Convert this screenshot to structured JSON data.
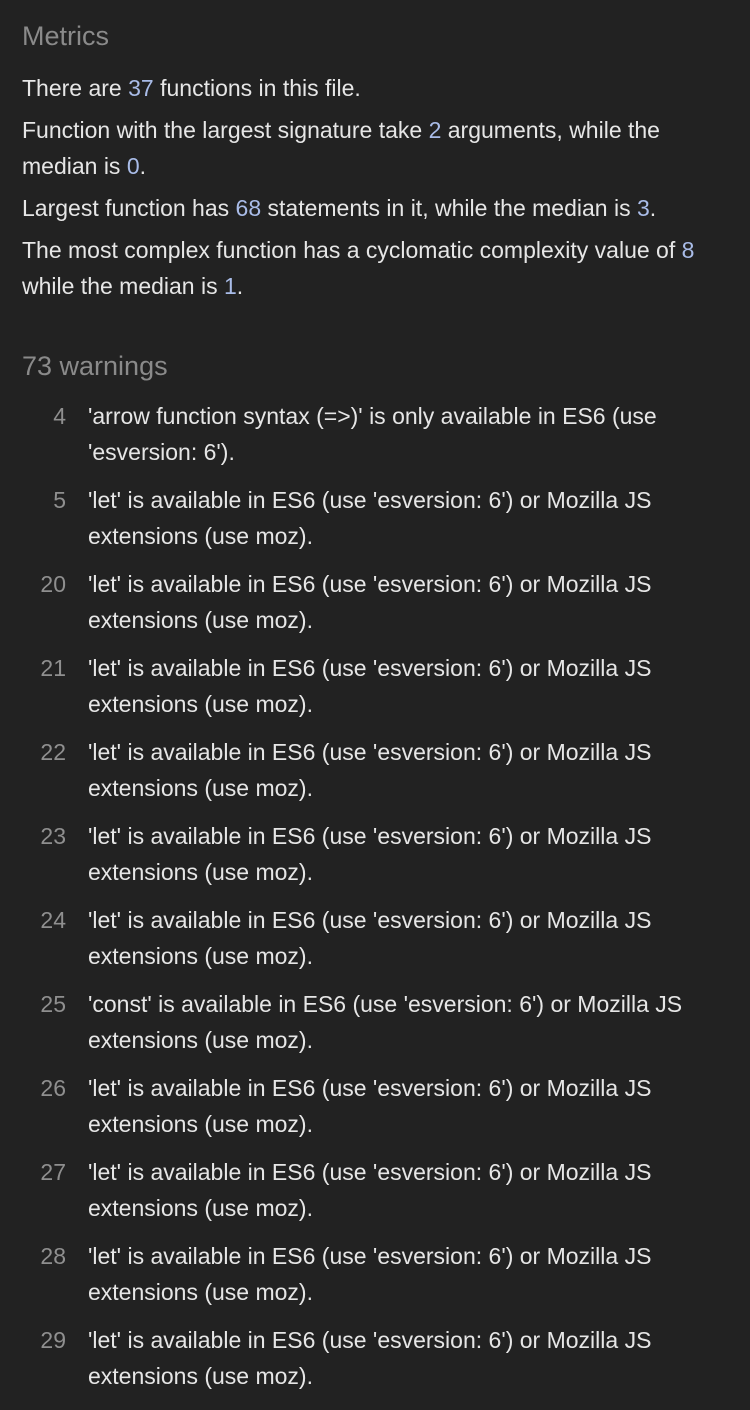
{
  "metrics": {
    "title": "Metrics",
    "line1": {
      "pre": "There are ",
      "value": "37",
      "post": " functions in this file."
    },
    "line2": {
      "pre": "Function with the largest signature take ",
      "v1": "2",
      "mid": " arguments, while the median is ",
      "v2": "0",
      "post": "."
    },
    "line3": {
      "pre": "Largest function has ",
      "v1": "68",
      "mid": " statements in it, while the median is ",
      "v2": "3",
      "post": "."
    },
    "line4": {
      "pre": "The most complex function has a cyclomatic complexity value of ",
      "v1": "8",
      "mid": " while the median is ",
      "v2": "1",
      "post": "."
    }
  },
  "warnings": {
    "title": "73 warnings",
    "items": [
      {
        "line": "4",
        "text": "'arrow function syntax (=>)' is only available in ES6 (use 'esversion: 6')."
      },
      {
        "line": "5",
        "text": "'let' is available in ES6 (use 'esversion: 6') or Mozilla JS extensions (use moz)."
      },
      {
        "line": "20",
        "text": "'let' is available in ES6 (use 'esversion: 6') or Mozilla JS extensions (use moz)."
      },
      {
        "line": "21",
        "text": "'let' is available in ES6 (use 'esversion: 6') or Mozilla JS extensions (use moz)."
      },
      {
        "line": "22",
        "text": "'let' is available in ES6 (use 'esversion: 6') or Mozilla JS extensions (use moz)."
      },
      {
        "line": "23",
        "text": "'let' is available in ES6 (use 'esversion: 6') or Mozilla JS extensions (use moz)."
      },
      {
        "line": "24",
        "text": "'let' is available in ES6 (use 'esversion: 6') or Mozilla JS extensions (use moz)."
      },
      {
        "line": "25",
        "text": "'const' is available in ES6 (use 'esversion: 6') or Mozilla JS extensions (use moz)."
      },
      {
        "line": "26",
        "text": "'let' is available in ES6 (use 'esversion: 6') or Mozilla JS extensions (use moz)."
      },
      {
        "line": "27",
        "text": "'let' is available in ES6 (use 'esversion: 6') or Mozilla JS extensions (use moz)."
      },
      {
        "line": "28",
        "text": "'let' is available in ES6 (use 'esversion: 6') or Mozilla JS extensions (use moz)."
      },
      {
        "line": "29",
        "text": "'let' is available in ES6 (use 'esversion: 6') or Mozilla JS extensions (use moz)."
      }
    ]
  }
}
